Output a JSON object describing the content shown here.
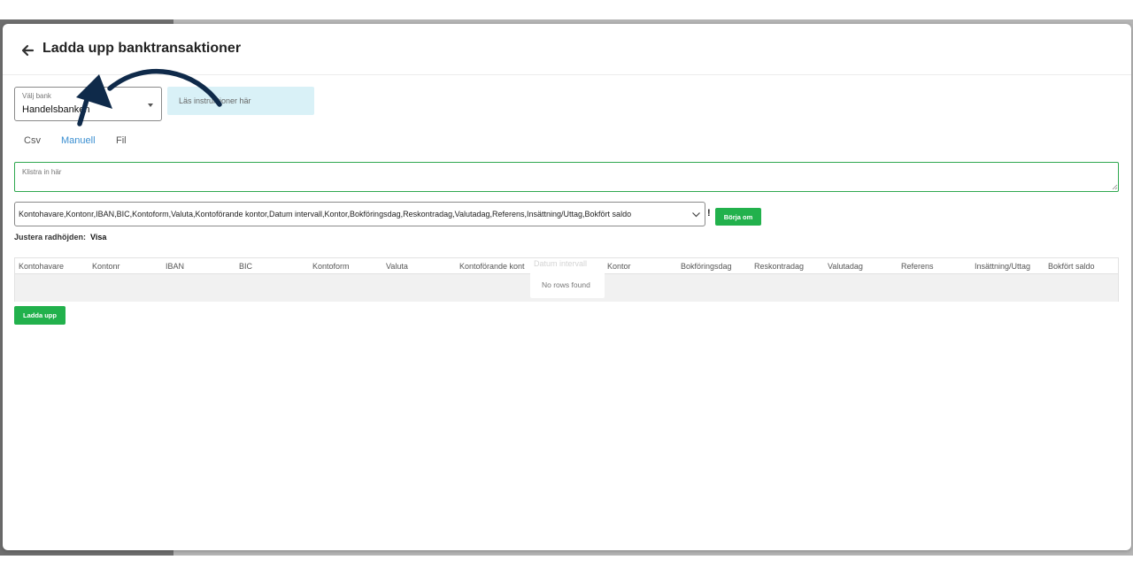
{
  "dialog": {
    "title": "Ladda upp banktransaktioner"
  },
  "bank_select": {
    "label": "Välj bank",
    "value": "Handelsbanken"
  },
  "info_box": {
    "text": "Läs instruktioner här"
  },
  "tabs": [
    {
      "label": "Csv",
      "active": false
    },
    {
      "label": "Manuell",
      "active": true
    },
    {
      "label": "Fil",
      "active": false
    }
  ],
  "paste_area": {
    "placeholder": "Klistra in här"
  },
  "column_select": {
    "value": "Kontohavare,Kontonr,IBAN,BIC,Kontoform,Valuta,Kontoförande kontor,Datum intervall,Kontor,Bokföringsdag,Reskontradag,Valutadag,Referens,Insättning/Uttag,Bokfört saldo",
    "warning_symbol": "!"
  },
  "buttons": {
    "restart_label": "Börja om",
    "upload_label": "Ladda upp"
  },
  "row_height": {
    "label": "Justera radhöjden:",
    "action": "Visa"
  },
  "grid": {
    "columns": [
      "Kontohavare",
      "Kontonr",
      "IBAN",
      "BIC",
      "Kontoform",
      "Valuta",
      "Kontoförande kont",
      "Kontor",
      "Bokföringsdag",
      "Reskontradag",
      "Valutadag",
      "Referens",
      "Insättning/Uttag",
      "Bokfört saldo"
    ],
    "hidden_column": "Datum intervall",
    "empty_message": "No rows found"
  },
  "colors": {
    "accent_green": "#22b14c",
    "tab_active": "#3b8fd1",
    "info_bg": "#d9f1f7",
    "arrow": "#0f2a4a"
  }
}
